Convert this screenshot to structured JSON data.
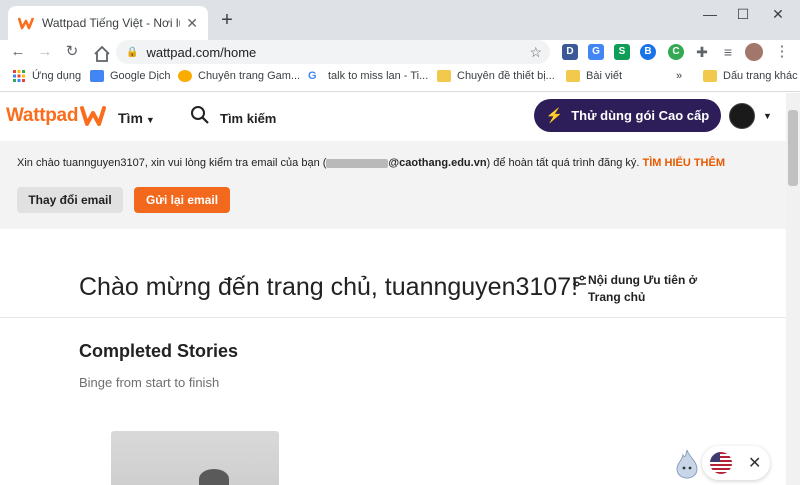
{
  "browser": {
    "tab_title": "Wattpad Tiếng Việt - Nơi lưu trữ",
    "tab_close": "✕",
    "new_tab": "+",
    "url": "wattpad.com/home",
    "window_controls": {
      "minimize": "—",
      "maximize": "☐",
      "close": "✕"
    },
    "nav": {
      "back": "←",
      "forward": "→",
      "reload": "↻"
    },
    "extensions": [
      "D",
      "G",
      "S",
      "B",
      "C"
    ],
    "bookmarks": [
      {
        "label": "Ứng dụng",
        "icon": "apps-grid-icon"
      },
      {
        "label": "Google Dịch",
        "icon": "google-translate-icon"
      },
      {
        "label": "Chuyên trang Gam...",
        "icon": "game-icon"
      },
      {
        "label": "talk to miss lan - Ti...",
        "icon": "google-icon"
      },
      {
        "label": "Chuyên đề thiết bị...",
        "icon": "folder-icon"
      },
      {
        "label": "Bài viết",
        "icon": "folder-icon"
      },
      {
        "label": "»",
        "icon": ""
      },
      {
        "label": "Dấu trang khác",
        "icon": "folder-icon"
      }
    ]
  },
  "header": {
    "logo_text": "Wattpad",
    "browse_label": "Tìm",
    "search_label": "Tìm kiếm",
    "premium_label": "Thử dùng gói Cao cấp"
  },
  "notice": {
    "text_before": "Xin chào tuannguyen3107, xin vui lòng kiểm tra email của bạn (",
    "email_domain": "@caothang.edu.vn",
    "text_after": ") để hoàn tất quá trình đăng ký.",
    "learn_more": "TÌM HIỂU THÊM",
    "change_email": "Thay đổi email",
    "resend_email": "Gửi lại email"
  },
  "main": {
    "welcome": "Chào mừng đến trang chủ, tuannguyen3107!",
    "preferences": "Nội dung Ưu tiên ở Trang chủ",
    "section_title": "Completed Stories",
    "section_subtitle": "Binge from start to finish"
  },
  "language_widget": {
    "close": "✕"
  },
  "colors": {
    "brand": "#f96d1d",
    "premium_bg": "#2d1e5a",
    "resend_bg": "#f2691e",
    "link": "#e55a00"
  }
}
